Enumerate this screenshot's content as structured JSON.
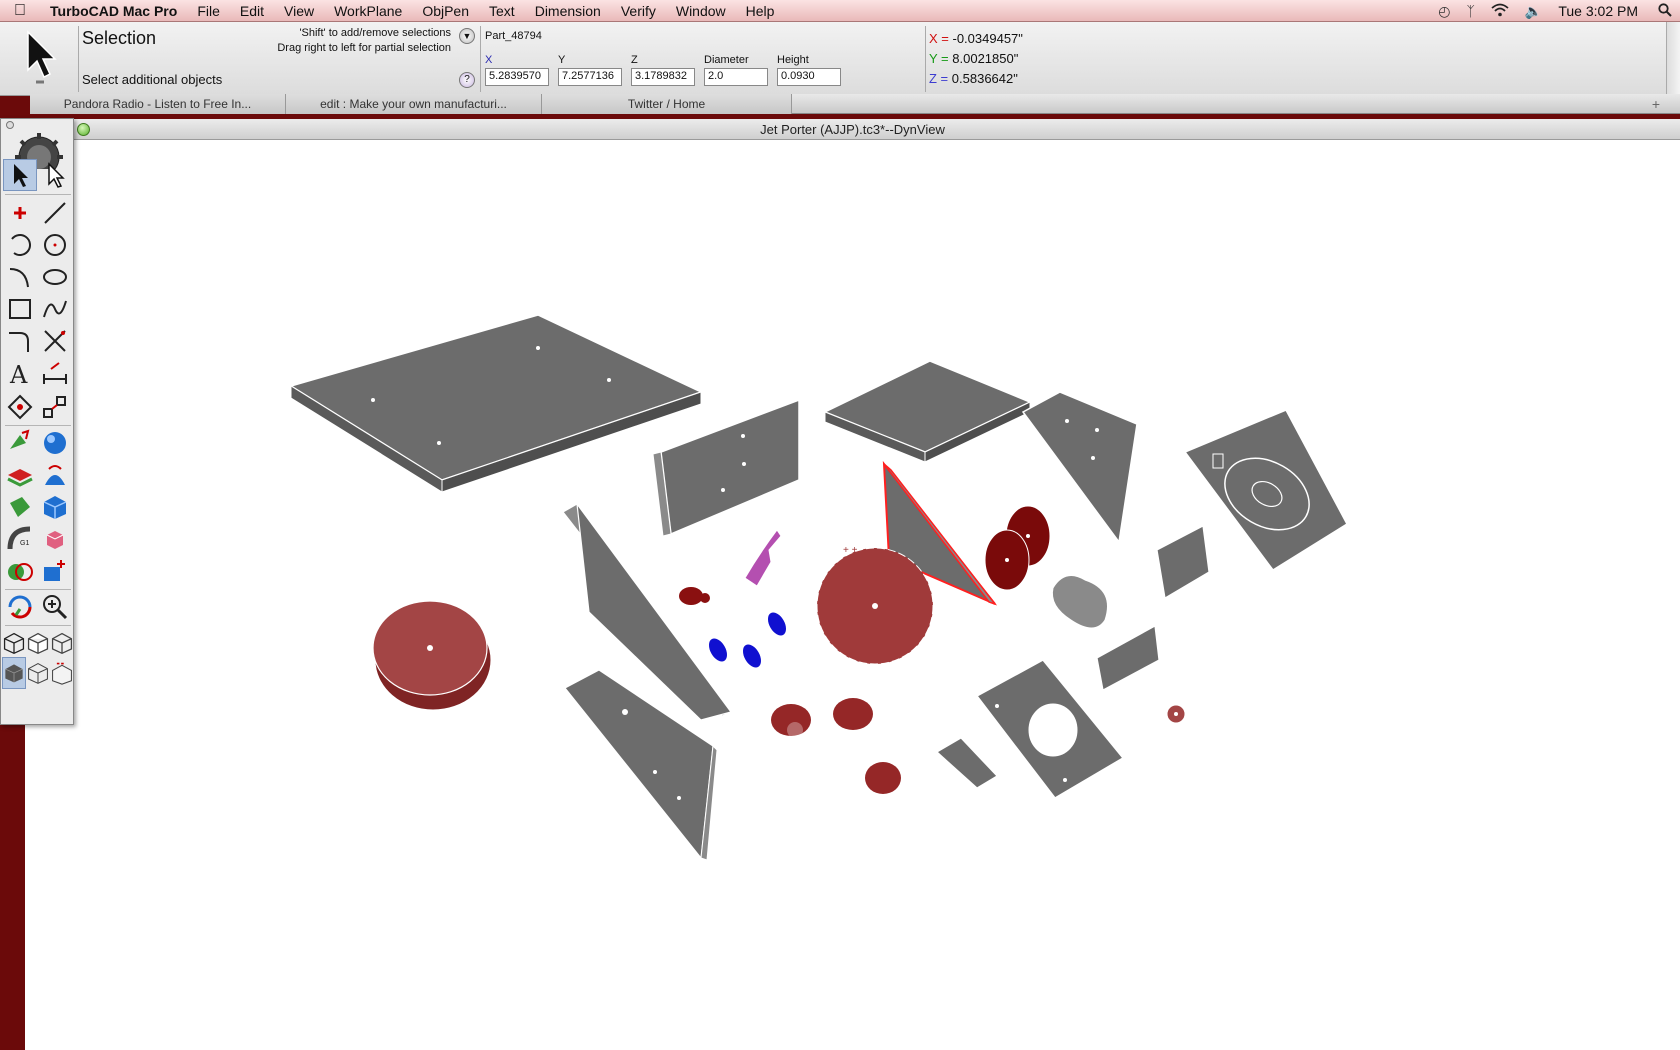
{
  "menubar": {
    "apple_icon": "apple-logo-icon",
    "app_name": "TurboCAD Mac Pro",
    "menus": [
      "File",
      "Edit",
      "View",
      "WorkPlane",
      "ObjPen",
      "Text",
      "Dimension",
      "Verify",
      "Window",
      "Help"
    ],
    "status_icons": [
      "time-machine-icon",
      "bluetooth-icon",
      "wifi-icon",
      "volume-icon"
    ],
    "clock": "Tue 3:02 PM",
    "search_icon": "spotlight-search-icon"
  },
  "inspector": {
    "mode_title": "Selection",
    "mode_help": "Select additional objects",
    "hint_line1": "'Shift' to add/remove selections",
    "hint_line2": "Drag right to left for partial selection",
    "part_name": "Part_48794",
    "fields": [
      {
        "label": "X",
        "value": "5.2839570"
      },
      {
        "label": "Y",
        "value": "7.2577136"
      },
      {
        "label": "Z",
        "value": "3.1789832"
      },
      {
        "label": "Diameter",
        "value": "2.0"
      },
      {
        "label": "Height",
        "value": "0.0930"
      }
    ],
    "coords": {
      "x_label": "X =",
      "x_value": "-0.0349457\"",
      "y_label": "Y =",
      "y_value": "8.0021850\"",
      "z_label": "Z =",
      "z_value": "0.5836642\""
    }
  },
  "browser_tabs": [
    {
      "label": "Pandora Radio - Listen to Free In..."
    },
    {
      "label": "edit : Make your own manufacturi..."
    },
    {
      "label": "Twitter / Home"
    }
  ],
  "browser_add_tab": "+",
  "window": {
    "title": "Jet Porter (AJJP).tc3*--DynView"
  },
  "palette": {
    "tools": [
      "select-icon",
      "select-edit-icon",
      "point-icon",
      "line-icon",
      "arc-icon",
      "circle-icon",
      "curve-icon",
      "ellipse-icon",
      "rectangle-icon",
      "spline-icon",
      "fillet-icon",
      "trim-icon",
      "text-icon",
      "dimension-icon",
      "transform-icon",
      "snap-icon",
      "extrude-icon",
      "sphere-icon",
      "add-plane-icon",
      "revolve-icon",
      "loft-icon",
      "box-icon",
      "sweep-icon",
      "boolean-icon",
      "union-icon",
      "solid-add-icon",
      "orbit-icon",
      "zoom-icon",
      "view-iso-icon",
      "view-wire-icon",
      "view-box-icon",
      "render-shaded-icon",
      "render-wire-icon",
      "render-hidden-icon"
    ]
  },
  "colors": {
    "desktop": "#6b0a0a",
    "part_gray": "#6c6c6c",
    "part_red": "#a03a3a",
    "part_purple": "#b44fb0",
    "part_blue": "#1010d0",
    "selection_red": "#ff2020"
  }
}
